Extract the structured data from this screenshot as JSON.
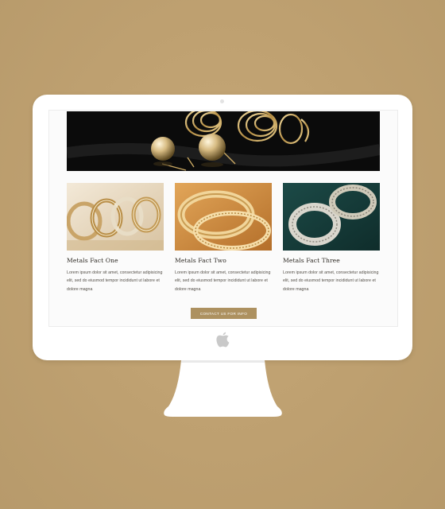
{
  "cards": [
    {
      "title": "Metals Fact One",
      "text": "Lorem ipsum dolor sit amet, consectetur adipisicing elit, sed do eiusmod tempor incididunt ut labore et dolore magna"
    },
    {
      "title": "Metals Fact Two",
      "text": "Lorem ipsum dolor sit amet, consectetur adipisicing elit, sed do eiusmod tempor incididunt ut labore et dolore magna"
    },
    {
      "title": "Metals Fact Three",
      "text": "Lorem ipsum dolor sit amet, consectetur adipisicing elit, sed do eiusmod tempor incididunt ut labore et dolore magna"
    }
  ],
  "cta": {
    "label": "CONTACT US FOR INFO"
  },
  "colors": {
    "background": "#bea070",
    "accent": "#ad9160",
    "bezel": "#ffffff"
  },
  "icons": {
    "logo": "apple-logo-icon"
  }
}
